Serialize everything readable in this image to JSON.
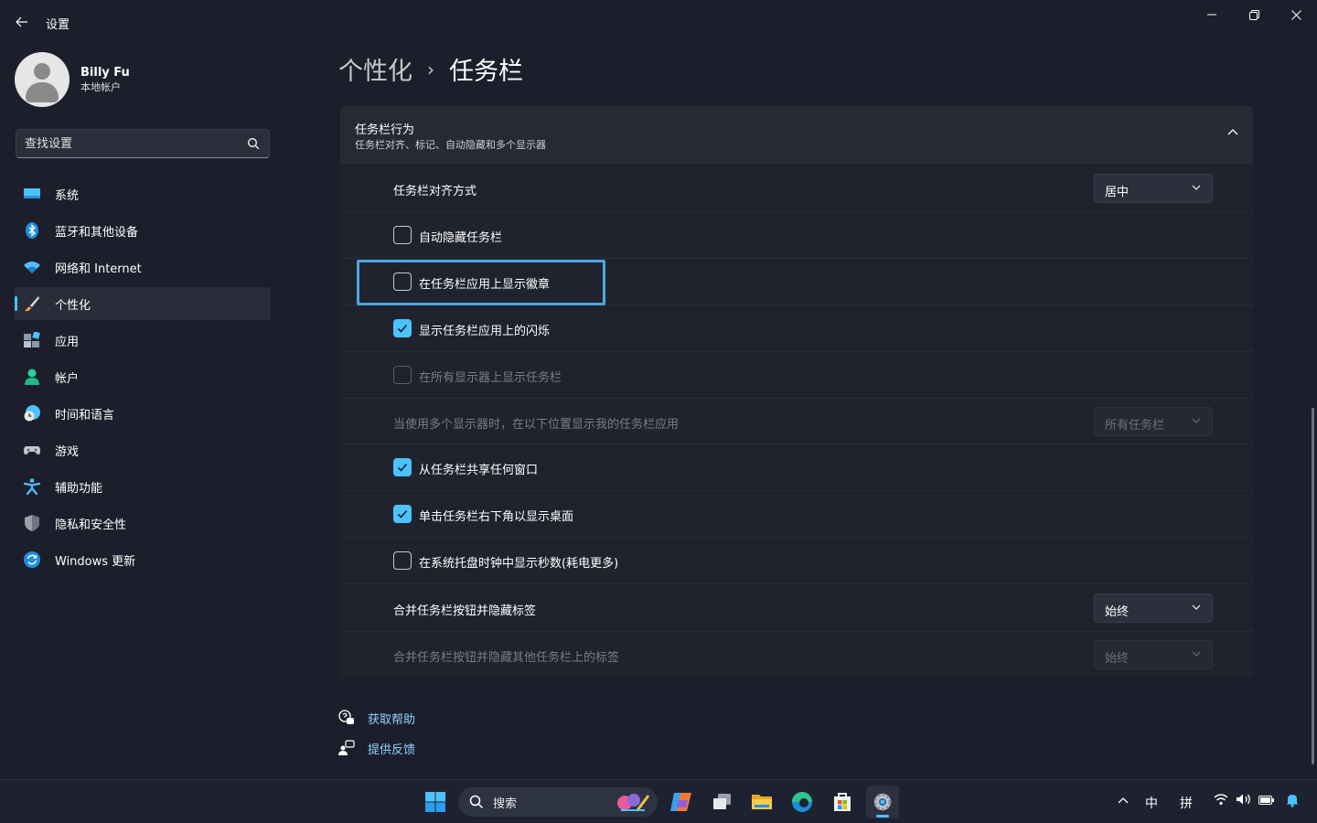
{
  "window": {
    "title": "设置",
    "icons": {
      "back": "back-arrow-icon",
      "minimize": "minimize-icon",
      "maximize": "maximize-icon",
      "close": "close-icon"
    }
  },
  "user": {
    "name": "Billy Fu",
    "account_type": "本地帐户"
  },
  "search": {
    "placeholder": "查找设置",
    "icon": "search-icon"
  },
  "sidebar": {
    "items": [
      {
        "label": "系统",
        "icon": "system-display-icon"
      },
      {
        "label": "蓝牙和其他设备",
        "icon": "bluetooth-icon"
      },
      {
        "label": "网络和 Internet",
        "icon": "wifi-icon"
      },
      {
        "label": "个性化",
        "icon": "brush-icon",
        "active": true
      },
      {
        "label": "应用",
        "icon": "apps-icon"
      },
      {
        "label": "帐户",
        "icon": "account-icon"
      },
      {
        "label": "时间和语言",
        "icon": "time-language-icon"
      },
      {
        "label": "游戏",
        "icon": "gamepad-icon"
      },
      {
        "label": "辅助功能",
        "icon": "accessibility-icon"
      },
      {
        "label": "隐私和安全性",
        "icon": "shield-icon"
      },
      {
        "label": "Windows 更新",
        "icon": "windows-update-icon"
      }
    ]
  },
  "breadcrumb": {
    "parent": "个性化",
    "separator": "›",
    "current": "任务栏"
  },
  "section": {
    "title": "任务栏行为",
    "subtitle": "任务栏对齐、标记、自动隐藏和多个显示器",
    "expanded": true
  },
  "settings": {
    "alignment": {
      "label": "任务栏对齐方式",
      "value": "居中"
    },
    "auto_hide": {
      "label": "自动隐藏任务栏",
      "checked": false
    },
    "badges": {
      "label": "在任务栏应用上显示徽章",
      "checked": false,
      "focused": true
    },
    "flashing": {
      "label": "显示任务栏应用上的闪烁",
      "checked": true
    },
    "all_displays": {
      "label": "在所有显示器上显示任务栏",
      "checked": false,
      "disabled": true
    },
    "multi_display": {
      "label": "当使用多个显示器时，在以下位置显示我的任务栏应用",
      "value": "所有任务栏",
      "disabled": true
    },
    "share_window": {
      "label": "从任务栏共享任何窗口",
      "checked": true
    },
    "corner_desktop": {
      "label": "单击任务栏右下角以显示桌面",
      "checked": true
    },
    "show_seconds": {
      "label": "在系统托盘时钟中显示秒数(耗电更多)",
      "checked": false
    },
    "combine": {
      "label": "合并任务栏按钮并隐藏标签",
      "value": "始终"
    },
    "combine_other": {
      "label": "合并任务栏按钮并隐藏其他任务栏上的标签",
      "value": "始终",
      "disabled": true
    }
  },
  "help_links": {
    "get_help": "获取帮助",
    "feedback": "提供反馈"
  },
  "taskbar": {
    "search_label": "搜索",
    "apps": [
      "start-icon",
      "copilot-icon",
      "task-view-icon",
      "file-explorer-icon",
      "edge-icon",
      "store-icon",
      "settings-icon"
    ],
    "ime_mode": "中",
    "ime_layout": "拼"
  },
  "colors": {
    "accent": "#4cc2ff",
    "background": "#1c1f2b",
    "card": "#20232e",
    "link": "#8fd3ff"
  }
}
